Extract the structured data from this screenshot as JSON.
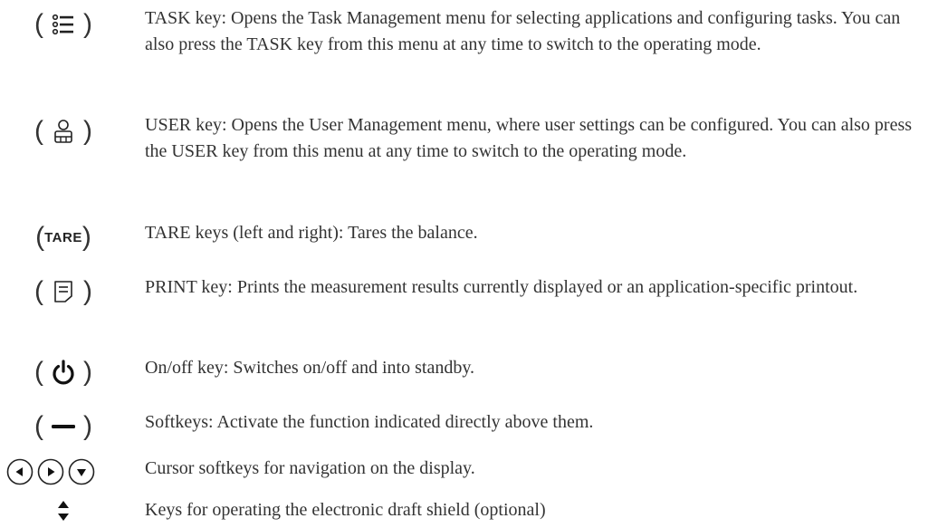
{
  "keys": [
    {
      "icon": "task-list-icon",
      "description": "TASK key: Opens the Task Management menu for selecting applications and configuring tasks. You can also press the TASK key from this menu at any time to switch to the operating mode."
    },
    {
      "icon": "user-icon",
      "description": "USER key: Opens the User Management menu, where user settings can be configured. You can also press the USER key from this menu at any time to switch to the operating mode."
    },
    {
      "icon": "tare-label",
      "label": "TARE",
      "description": "TARE keys (left and right): Tares the balance."
    },
    {
      "icon": "print-icon",
      "description": "PRINT key: Prints the measurement results currently displayed or an application-specific printout."
    },
    {
      "icon": "power-icon",
      "description": "On/off key: Switches on/off and into standby."
    },
    {
      "icon": "softkey-dash-icon",
      "description": "Softkeys: Activate the function indicated directly above them."
    },
    {
      "icon": "cursor-arrows-icon",
      "description": "Cursor softkeys for navigation on the display."
    },
    {
      "icon": "up-down-arrows-icon",
      "description": "Keys for operating the electronic draft shield (optional)"
    }
  ]
}
